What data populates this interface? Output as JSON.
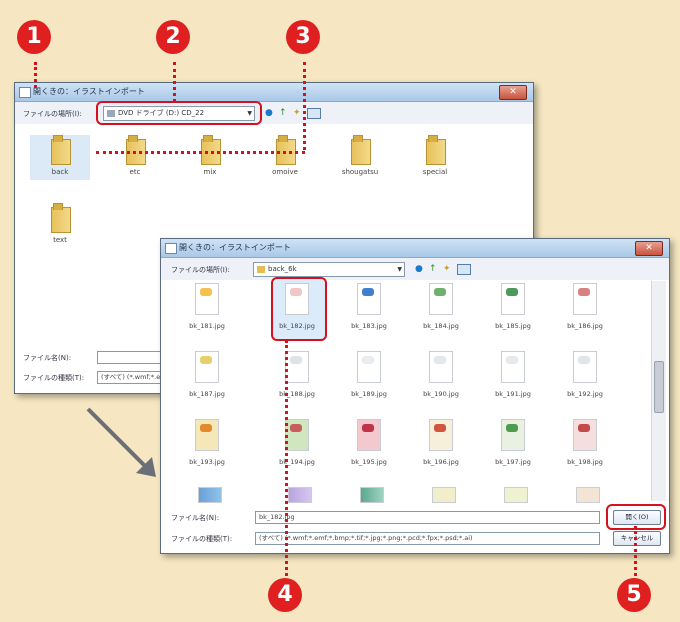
{
  "badges": [
    "1",
    "2",
    "3",
    "4",
    "5"
  ],
  "dialog_back": {
    "title": "開くきの：イラストインポート",
    "lookin_label": "ファイルの場所(I):",
    "lookin_value": "DVD ドライブ (D:) CD_22",
    "folders": [
      "back",
      "etc",
      "mix",
      "omoive",
      "shougatsu",
      "special",
      "text"
    ],
    "filename_label": "ファイル名(N):",
    "filetype_label": "ファイルの種類(T):",
    "filetype_value": "(すべて) (*.wmf;*.emf..."
  },
  "dialog_front": {
    "title": "開くきの：イラストインポート",
    "lookin_label": "ファイルの場所(I):",
    "lookin_value": "back_6k",
    "files": [
      "bk_181.jpg",
      "bk_182.jpg",
      "bk_183.jpg",
      "bk_184.jpg",
      "bk_185.jpg",
      "bk_186.jpg",
      "bk_187.jpg",
      "bk_188.jpg",
      "bk_189.jpg",
      "bk_190.jpg",
      "bk_191.jpg",
      "bk_192.jpg",
      "bk_193.jpg",
      "bk_194.jpg",
      "bk_195.jpg",
      "bk_196.jpg",
      "bk_197.jpg",
      "bk_198.jpg"
    ],
    "filename_label": "ファイル名(N):",
    "filename_value": "bk_182.jpg",
    "filetype_label": "ファイルの種類(T):",
    "filetype_value": "(すべて) (*.wmf;*.emf;*.bmp;*.tif;*.jpg;*.png;*.pcd;*.fpx;*.psd;*.ai)",
    "open_button": "開く(O)",
    "cancel_button": "キャンセル"
  },
  "colors": {
    "accent_red": "#d6101c",
    "background": "#f6e7c2"
  }
}
